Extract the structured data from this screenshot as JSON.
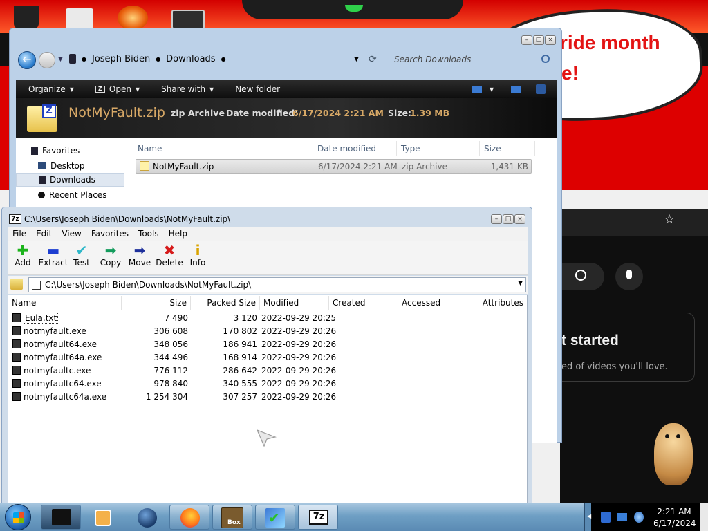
{
  "desktop": {
    "bubble_line1": "ride month",
    "bubble_line2": "e!",
    "panel_title": "t started",
    "panel_sub": "ed of videos you'll love."
  },
  "explorer": {
    "breadcrumb": [
      "Joseph Biden",
      "Downloads"
    ],
    "search_placeholder": "Search Downloads",
    "toolbar": {
      "organize": "Organize",
      "open": "Open",
      "share_with": "Share with",
      "new_folder": "New folder"
    },
    "details": {
      "name": "NotMyFault.zip",
      "type": "zip Archive",
      "modified_label": "Date modified:",
      "modified_value": "6/17/2024 2:21 AM",
      "size_label": "Size:",
      "size_value": "1.39 MB"
    },
    "nav": {
      "favorites": "Favorites",
      "desktop": "Desktop",
      "downloads": "Downloads",
      "recent": "Recent Places"
    },
    "columns": [
      "Name",
      "Date modified",
      "Type",
      "Size"
    ],
    "files": [
      {
        "name": "NotMyFault.zip",
        "modified": "6/17/2024 2:21 AM",
        "type": "zip Archive",
        "size": "1,431 KB"
      }
    ]
  },
  "sevenzip": {
    "title": "C:\\Users\\Joseph Biden\\Downloads\\NotMyFault.zip\\",
    "menu": [
      "File",
      "Edit",
      "View",
      "Favorites",
      "Tools",
      "Help"
    ],
    "toolbar": [
      "Add",
      "Extract",
      "Test",
      "Copy",
      "Move",
      "Delete",
      "Info"
    ],
    "path": "C:\\Users\\Joseph Biden\\Downloads\\NotMyFault.zip\\",
    "columns": [
      "Name",
      "Size",
      "Packed Size",
      "Modified",
      "Created",
      "Accessed",
      "Attributes"
    ],
    "rows": [
      {
        "name": "Eula.txt",
        "size": "7 490",
        "packed": "3 120",
        "modified": "2022-09-29 20:25"
      },
      {
        "name": "notmyfault.exe",
        "size": "306 608",
        "packed": "170 802",
        "modified": "2022-09-29 20:26"
      },
      {
        "name": "notmyfault64.exe",
        "size": "348 056",
        "packed": "186 941",
        "modified": "2022-09-29 20:26"
      },
      {
        "name": "notmyfault64a.exe",
        "size": "344 496",
        "packed": "168 914",
        "modified": "2022-09-29 20:26"
      },
      {
        "name": "notmyfaultc.exe",
        "size": "776 112",
        "packed": "286 642",
        "modified": "2022-09-29 20:26"
      },
      {
        "name": "notmyfaultc64.exe",
        "size": "978 840",
        "packed": "340 555",
        "modified": "2022-09-29 20:26"
      },
      {
        "name": "notmyfaultc64a.exe",
        "size": "1 254 304",
        "packed": "307 257",
        "modified": "2022-09-29 20:26"
      }
    ]
  },
  "taskbar": {
    "time": "2:21 AM",
    "date": "6/17/2024",
    "box_label": "Box",
    "sevenzip_label": "7z"
  },
  "colors": {
    "brand_red": "#e31414",
    "flag_red": "#dd0000",
    "flag_gold": "#ffce00"
  }
}
